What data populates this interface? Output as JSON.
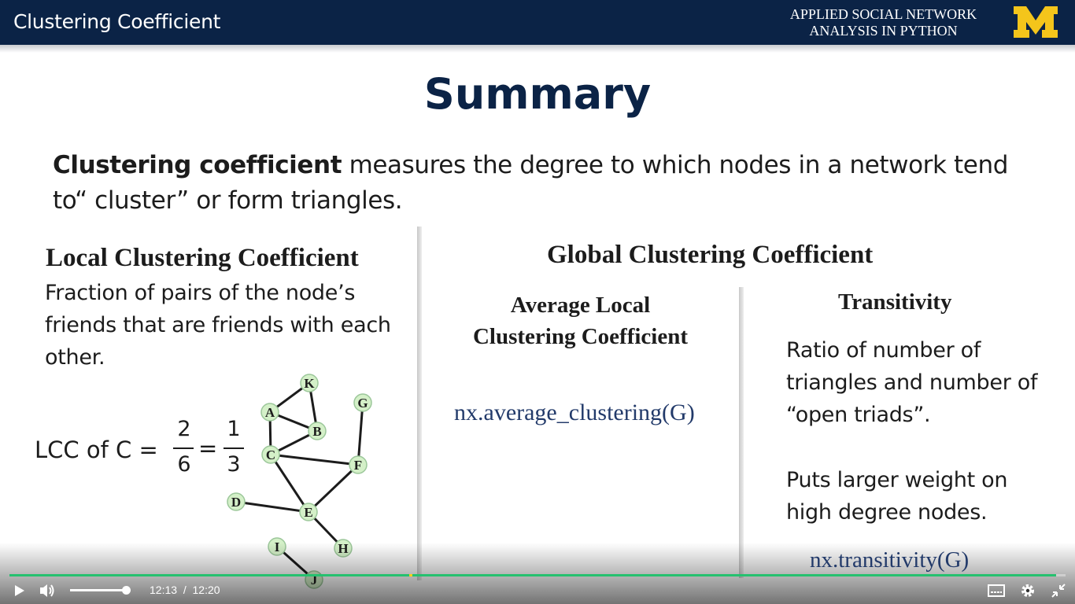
{
  "header": {
    "title": "Clustering Coefficient",
    "course_line1": "APPLIED SOCIAL NETWORK",
    "course_line2": "ANALYSIS IN PYTHON",
    "logo_letter": "M",
    "logo_color": "#f4c51b",
    "bar_color": "#0b2346"
  },
  "slide": {
    "heading": "Summary",
    "intro_bold": "Clustering coefficient",
    "intro_rest": " measures the degree to which nodes in a network tend to“ cluster” or form triangles.",
    "local": {
      "title": "Local Clustering Coefficient",
      "desc_line1": "Fraction of pairs of the node’s",
      "desc_line2": "friends that are friends with each",
      "desc_line3": "other.",
      "formula_label": "LCC of C =",
      "num1": "2",
      "den1": "6",
      "eq": "=",
      "num2": "1",
      "den2": "3"
    },
    "global": {
      "title": "Global Clustering Coefficient",
      "avg_title_line1": "Average Local",
      "avg_title_line2": "Clustering Coefficient",
      "avg_code": "nx.average_clustering(G)",
      "trans_title": "Transitivity",
      "trans_desc_line1": "Ratio of number of",
      "trans_desc_line2": "triangles and number of",
      "trans_desc_line3": "“open triads”.",
      "trans_desc2_line1": "Puts larger weight on",
      "trans_desc2_line2": "high degree nodes.",
      "trans_code": "nx.transitivity(G)"
    },
    "graph": {
      "nodes": [
        "K",
        "G",
        "A",
        "B",
        "C",
        "F",
        "D",
        "E",
        "I",
        "H",
        "J"
      ],
      "edges": [
        [
          "A",
          "K"
        ],
        [
          "K",
          "B"
        ],
        [
          "A",
          "B"
        ],
        [
          "A",
          "C"
        ],
        [
          "B",
          "C"
        ],
        [
          "C",
          "F"
        ],
        [
          "C",
          "E"
        ],
        [
          "F",
          "G"
        ],
        [
          "F",
          "E"
        ],
        [
          "D",
          "E"
        ],
        [
          "E",
          "H"
        ],
        [
          "I",
          "J"
        ]
      ],
      "node_fill": "#d4f0c8"
    }
  },
  "player": {
    "current_time": "12:13",
    "separator": "/",
    "duration": "12:20",
    "progress_fraction": 0.991,
    "volume_fraction": 0.92,
    "accent_color": "#25c16f",
    "icons": [
      "play-icon",
      "volume-icon",
      "captions-icon",
      "settings-icon",
      "exit-fullscreen-icon"
    ]
  }
}
